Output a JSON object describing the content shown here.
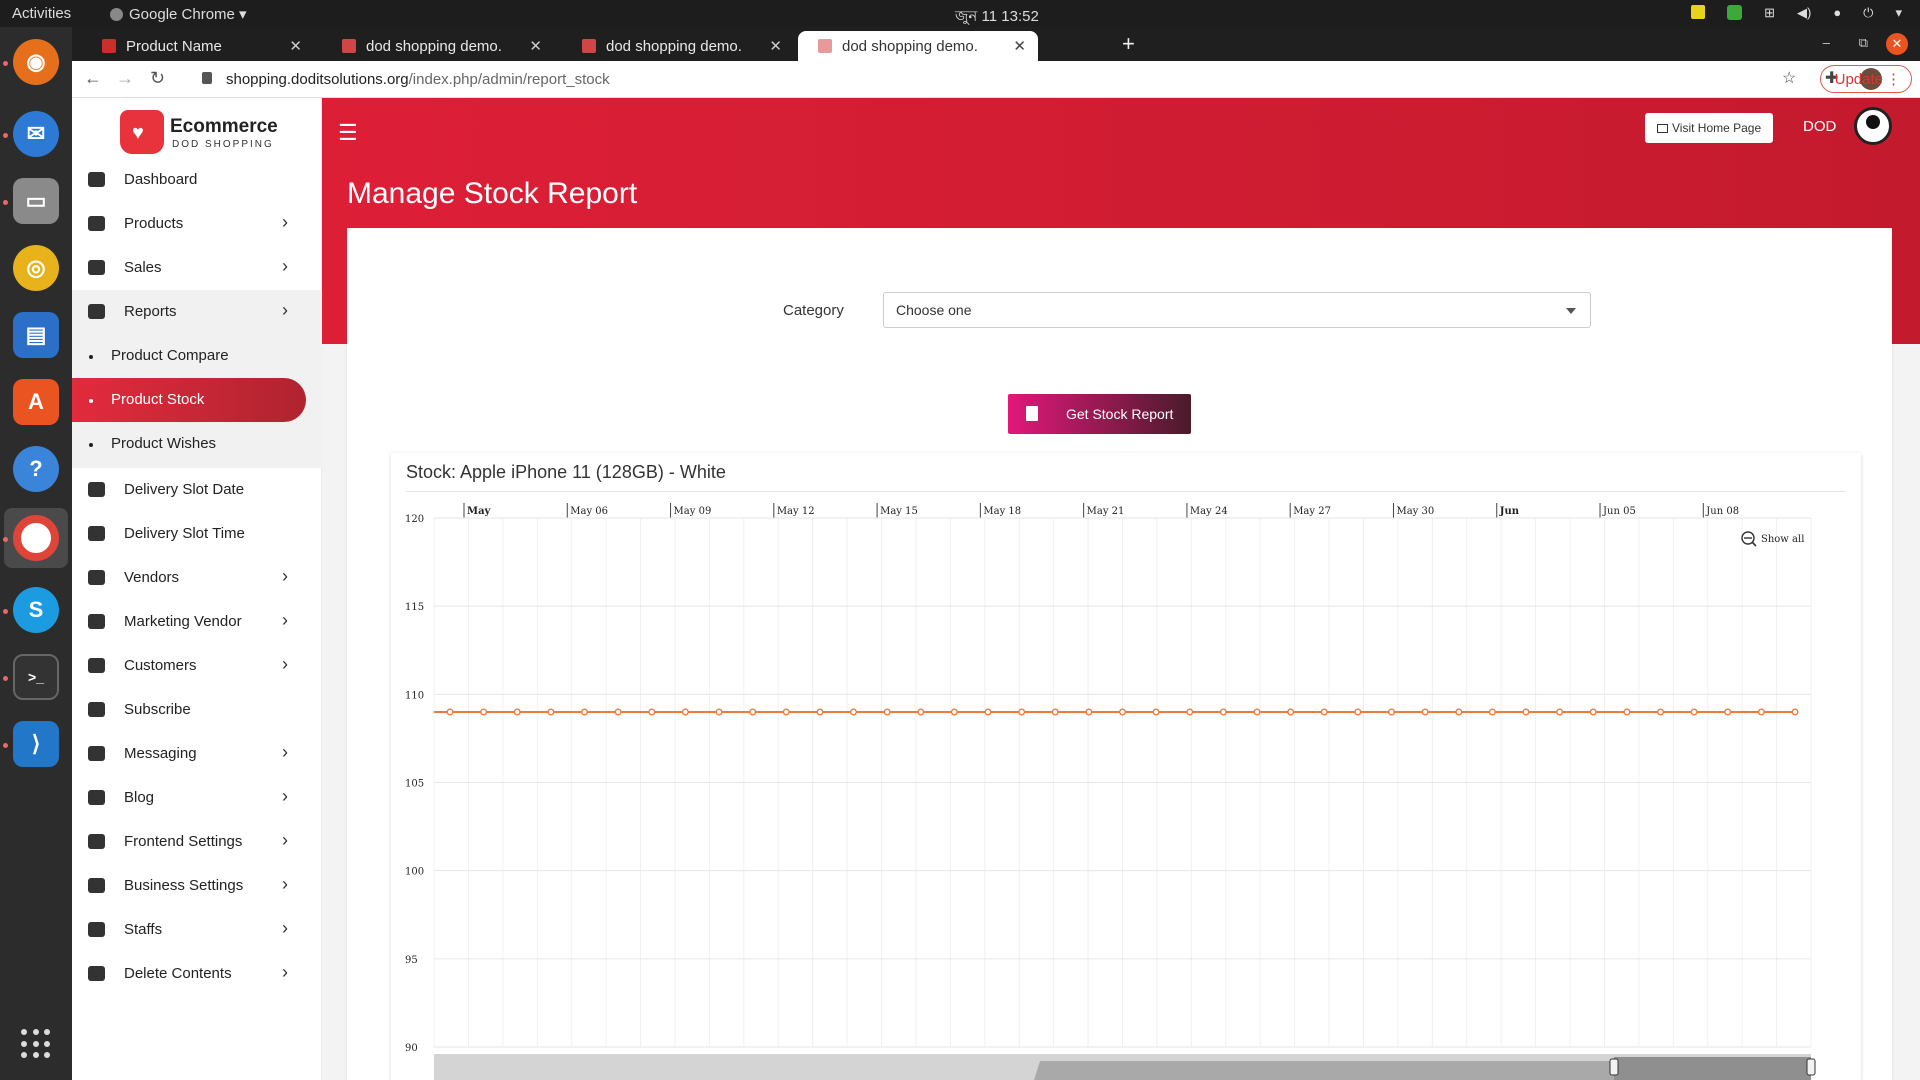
{
  "os": {
    "activities": "Activities",
    "app_name": "Google Chrome",
    "clock": "জুন 11  13:52"
  },
  "browser": {
    "tabs": [
      {
        "title": "Product Name",
        "favicon_color": "#c9302c"
      },
      {
        "title": "dod shopping demo.",
        "favicon_color": "#d04545"
      },
      {
        "title": "dod shopping demo.",
        "favicon_color": "#d04545"
      },
      {
        "title": "dod shopping demo.",
        "favicon_color": "#e89a9a"
      }
    ],
    "active_tab": 3,
    "url_domain": "shopping.doditsolutions.org",
    "url_path": "/index.php/admin/report_stock",
    "update_label": "Update"
  },
  "logo": {
    "title": "Ecommerce",
    "subtitle": "DOD SHOPPING"
  },
  "sidebar": {
    "items": [
      {
        "label": "Dashboard",
        "icon": "dashboard-icon",
        "chevron": false
      },
      {
        "label": "Products",
        "icon": "cart-icon",
        "chevron": true
      },
      {
        "label": "Sales",
        "icon": "cart-icon",
        "chevron": true
      },
      {
        "label": "Reports",
        "icon": "file-icon",
        "chevron": true
      },
      {
        "label": "Product Compare",
        "sub": true
      },
      {
        "label": "Product Stock",
        "sub": true,
        "active": true
      },
      {
        "label": "Product Wishes",
        "sub": true
      },
      {
        "label": "Delivery Slot Date",
        "icon": "dashboard-icon",
        "chevron": false
      },
      {
        "label": "Delivery Slot Time",
        "icon": "dashboard-icon",
        "chevron": false
      },
      {
        "label": "Vendors",
        "icon": "user-plus-icon",
        "chevron": true
      },
      {
        "label": "Marketing Vendor",
        "icon": "file-icon",
        "chevron": true
      },
      {
        "label": "Customers",
        "icon": "users-icon",
        "chevron": true
      },
      {
        "label": "Subscribe",
        "icon": "users-icon",
        "chevron": false
      },
      {
        "label": "Messaging",
        "icon": "envelope-icon",
        "chevron": true
      },
      {
        "label": "Blog",
        "icon": "user-icon",
        "chevron": true
      },
      {
        "label": "Frontend Settings",
        "icon": "monitor-icon",
        "chevron": true
      },
      {
        "label": "Business Settings",
        "icon": "briefcase-icon",
        "chevron": true
      },
      {
        "label": "Staffs",
        "icon": "user-icon",
        "chevron": true
      },
      {
        "label": "Delete Contents",
        "icon": "trash-icon",
        "chevron": true
      }
    ]
  },
  "header": {
    "visit_label": "Visit Home Page",
    "user_name": "DOD",
    "accent": "#dd1f36"
  },
  "main": {
    "page_title": "Manage Stock Report",
    "category_label": "Category",
    "category_value": "Choose one",
    "button_label": "Get Stock Report"
  },
  "chart_data": {
    "type": "line",
    "title": "Stock: Apple iPhone 11 (128GB) - White",
    "show_all_label": "Show all",
    "x_tick_labels": [
      "May",
      "May 06",
      "May 09",
      "May 12",
      "May 15",
      "May 18",
      "May 21",
      "May 24",
      "May 27",
      "May 30",
      "Jun",
      "Jun 05",
      "Jun 08"
    ],
    "x_start": "2021-05-01",
    "y_tick_labels": [
      "120",
      "115",
      "110",
      "105",
      "100",
      "95",
      "90"
    ],
    "ylim": [
      90,
      120
    ],
    "series": [
      {
        "color": "#f07a3c",
        "value": 109,
        "point_count": 41
      }
    ],
    "grid": true,
    "navigator": true
  }
}
